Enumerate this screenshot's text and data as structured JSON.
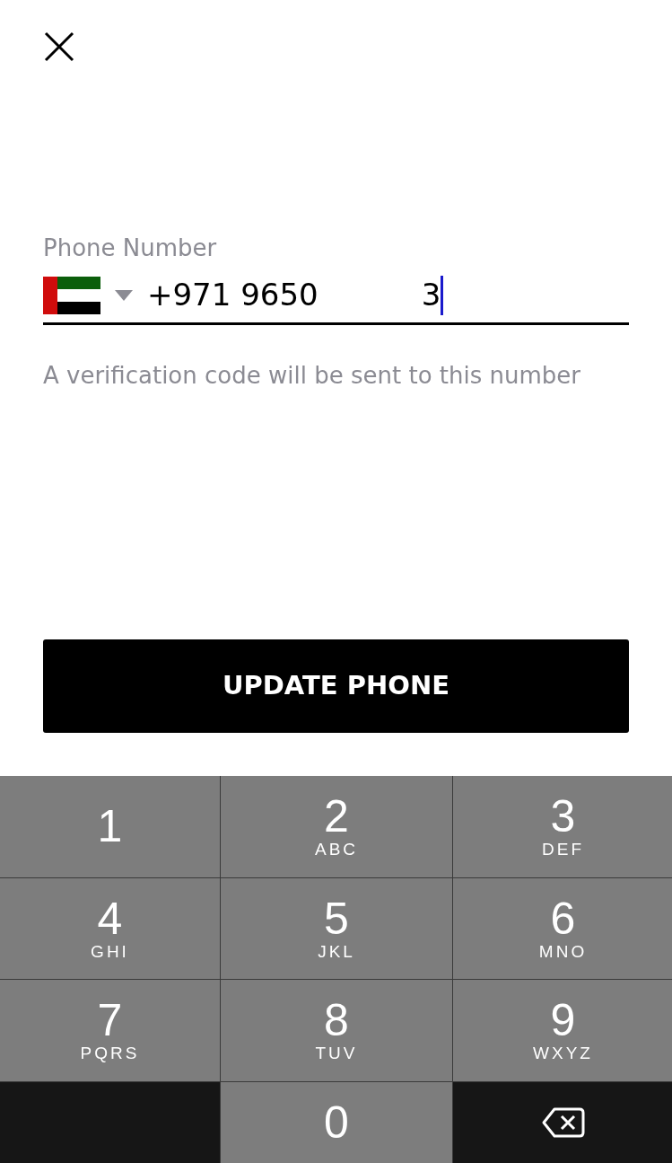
{
  "close_button": {
    "kind": "close"
  },
  "phone_field": {
    "label": "Phone Number",
    "flag": {
      "kind": "uae"
    },
    "value_parts": [
      "+971 9650",
      "3"
    ],
    "focused": true
  },
  "hint": "A verification code will be sent to this number",
  "submit_button": {
    "label": "UPDATE PHONE"
  },
  "keypad": [
    {
      "kind": "digit",
      "digit": "1"
    },
    {
      "kind": "digit",
      "digit": "2",
      "letters": "ABC"
    },
    {
      "kind": "digit",
      "digit": "3",
      "letters": "DEF"
    },
    {
      "kind": "digit",
      "digit": "4",
      "letters": "GHI"
    },
    {
      "kind": "digit",
      "digit": "5",
      "letters": "JKL"
    },
    {
      "kind": "digit",
      "digit": "6",
      "letters": "MNO"
    },
    {
      "kind": "digit",
      "digit": "7",
      "letters": "PQRS"
    },
    {
      "kind": "digit",
      "digit": "8",
      "letters": "TUV"
    },
    {
      "kind": "digit",
      "digit": "9",
      "letters": "WXYZ"
    },
    {
      "kind": "blank"
    },
    {
      "kind": "digit",
      "digit": "0"
    },
    {
      "kind": "delete"
    }
  ]
}
